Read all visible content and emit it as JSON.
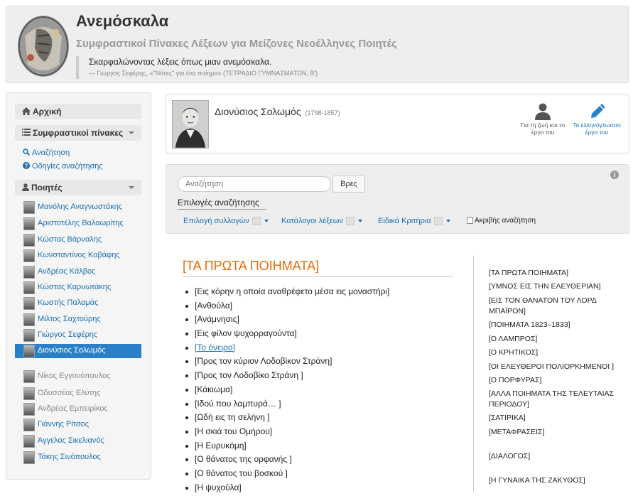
{
  "header": {
    "title": "Ανεμόσκαλα",
    "subtitle": "Συμφραστικοί Πίνακες Λέξεων για Μείζονες Νεοέλληνες Ποιητές",
    "quote": "Σκαρφαλώνοντας λέξεις όπως μιαν ανεμόσκαλα.",
    "quote_source": "— Γιώργος Σεφέρης, «\"Νότες\" για ένα ποίημα» (ΤΕΤΡΑΔΙΟ ΓΥΜΝΑΣΜΑΤΩΝ, Β')"
  },
  "sidebar": {
    "home": "Αρχική",
    "tables": "Συμφραστικοί πίνακες",
    "search": "Αναζήτηση",
    "help": "Οδηγίες αναζήτησης",
    "poets_label": "Ποιητές",
    "poets": [
      "Μανόλης Αναγνωστάκης",
      "Αριστοτέλης Βαλαωρίτης",
      "Κώστας Βάρναλης",
      "Κωνσταντίνος Καβάφης",
      "Ανδρέας Κάλβος",
      "Κώστας Καρυωτάκης",
      "Κωστής Παλαμάς",
      "Μίλτος Σαχτούρης",
      "Γιώργος Σεφέρης",
      "Διονύσιος Σολωμός"
    ],
    "poets_inactive": [
      "Νίκος Εγγονόπουλος",
      "Οδυσσέας Ελύτης",
      "Ανδρέας Εμπειρίκος",
      "Γιάννης Ρίτσος",
      "Άγγελος Σικελιανός",
      "Τάκης Σινόπουλος"
    ]
  },
  "poet": {
    "name": "Διονύσιος Σολωμός",
    "years": "(1798-1857)",
    "life_label": "Για τη ζωή και το έργο του",
    "work_label": "Το ελληνόγλωσσο έργο του"
  },
  "search": {
    "placeholder": "Αναζήτηση",
    "button": "Βρες",
    "options_title": "Επιλογές αναζήτησης",
    "opt_collections": "Επιλογή συλλογών",
    "opt_wordlists": "Κατάλογοι λέξεων",
    "opt_criteria": "Ειδικά Κριτήρια",
    "exact": "Ακριβής αναζήτηση",
    "info_glyph": "i"
  },
  "collection": {
    "title": "[ΤΑ ΠΡΩΤΑ ΠΟΙΗΜΑΤΑ]",
    "poems": [
      "[Εις κόρην η οποία αναθρέφετο μέσα εις μοναστήρι]",
      "[Ανθούλα]",
      "[Ανάμνησις]",
      "[Εις φίλον ψυχορραγούντα]",
      "[Το όνειρο]",
      "[Προς τον κύριον Λοδοβίκον Στράνη]",
      "[Προς τον Λοδοβίκο Στράνη ]",
      "[Κάκιωμα]",
      "[Ιδού που λαμπυρά… ]",
      "[Ωδή εις τη σελήνη ]",
      "[Η σκιά του Ομήρου]",
      "[Η Ευρυκόμη]",
      "[Ο θάνατος της ορφανής ]",
      "[Ο θάνατος του βοσκού ]",
      "[Η ψυχούλα]"
    ]
  },
  "collections": [
    "[ΤΑ ΠΡΩΤΑ ΠΟΙΗΜΑΤΑ]",
    "[ΥΜΝΟΣ ΕΙΣ ΤΗΝ ΕΛΕΥΘΕΡΙΑΝ]",
    "[ΕΙΣ ΤΟΝ ΘΑΝΑΤΟΝ ΤΟΥ ΛΟΡΔ ΜΠΑΪΡΟΝ]",
    "[ΠΟΙΗΜΑΤΑ 1823–1833]",
    "[Ο ΛΑΜΠΡΟΣ]",
    "[Ο ΚΡΗΤΙΚΟΣ]",
    "[ΟΙ ΕΛΕΥΘΕΡΟΙ ΠΟΛΙΟΡΚΗΜΕΝΟΙ ]",
    "[Ο ΠΟΡΦΥΡΑΣ]",
    "[ΑΛΛΑ ΠΟΙΗΜΑΤΑ ΤΗΣ ΤΕΛΕΥΤΑΙΑΣ ΠΕΡΙΟΔΟΥ]",
    "[ΣΑΤΙΡΙΚΑ]",
    "[ΜΕΤΑΦΡΑΣΕΙΣ]",
    "[ΔΙΑΛΟΓΟΣ]",
    "[Η ΓΥΝΑΙΚΑ ΤΗΣ ΖΑΚΥΘΟΣ]"
  ],
  "colors": {
    "accent": "#2a80c6",
    "link": "#1a6fb3",
    "collection_title": "#e36c09"
  }
}
